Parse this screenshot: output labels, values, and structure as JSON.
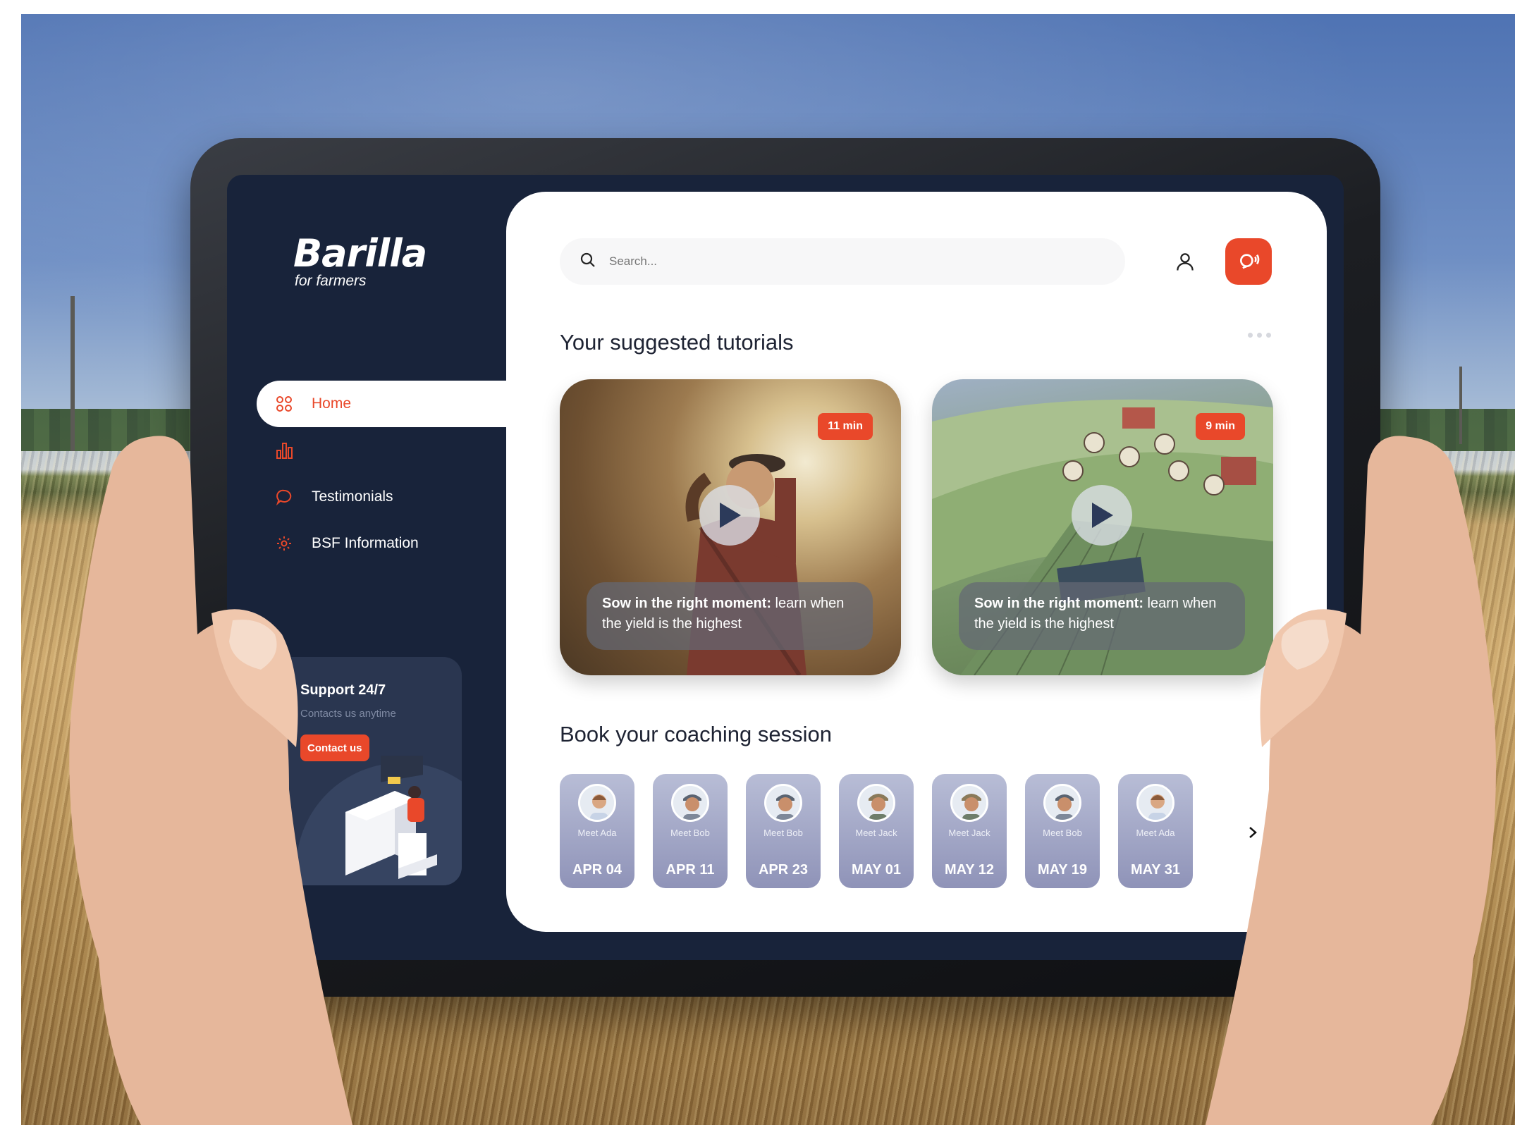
{
  "brand": {
    "name": "Barilla",
    "tagline": "for farmers"
  },
  "nav": {
    "items": [
      {
        "label": "Home",
        "icon": "grid-icon",
        "active": true
      },
      {
        "label": "",
        "icon": "bar-chart-icon",
        "active": false
      },
      {
        "label": "Testimonials",
        "icon": "chat-bubble-icon",
        "active": false
      },
      {
        "label": "BSF Information",
        "icon": "gear-icon",
        "active": false
      }
    ]
  },
  "support": {
    "title": "Support 24/7",
    "subtitle": "Contacts us anytime",
    "button": "Contact us"
  },
  "header": {
    "search_placeholder": "Search...",
    "user_icon": "user-icon",
    "notification_icon": "chat-notification-icon"
  },
  "tutorials": {
    "title": "Your suggested tutorials",
    "items": [
      {
        "duration": "11 min",
        "caption_bold": "Sow in the right moment:",
        "caption_rest": " learn when the yield is the highest"
      },
      {
        "duration": "9 min",
        "caption_bold": "Sow in the right moment:",
        "caption_rest": " learn when the yield is the highest"
      }
    ]
  },
  "coaching": {
    "title": "Book your coaching session",
    "sessions": [
      {
        "who": "Meet Ada",
        "date": "APR 04"
      },
      {
        "who": "Meet Bob",
        "date": "APR 11"
      },
      {
        "who": "Meet Bob",
        "date": "APR 23"
      },
      {
        "who": "Meet Jack",
        "date": "MAY 01"
      },
      {
        "who": "Meet Jack",
        "date": "MAY 12"
      },
      {
        "who": "Meet Bob",
        "date": "MAY 19"
      },
      {
        "who": "Meet Ada",
        "date": "MAY 31"
      }
    ]
  },
  "colors": {
    "accent": "#e9482a",
    "sidebar_bg": "#18233a",
    "panel_bg": "#ffffff"
  }
}
